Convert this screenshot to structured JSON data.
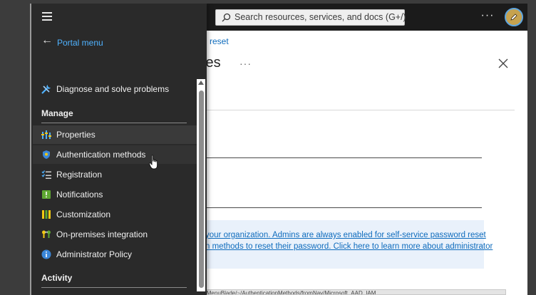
{
  "topbar": {
    "search_placeholder": "Search resources, services, and docs (G+/)",
    "more_label": "···"
  },
  "main": {
    "breadcrumb_fragment": "d reset",
    "title_fragment": "ies",
    "title_more": "···",
    "info_line1": "your organization. Admins are always enabled for self-service password reset",
    "info_line2": "n methods to reset their password. Click here to learn more about administrator"
  },
  "sidebar": {
    "back_label": "Portal menu",
    "top_item": {
      "label": "Diagnose and solve problems",
      "icon": "wrench-icon"
    },
    "section_manage": "Manage",
    "items": [
      {
        "label": "Properties",
        "icon": "properties-icon"
      },
      {
        "label": "Authentication methods",
        "icon": "shield-icon"
      },
      {
        "label": "Registration",
        "icon": "registration-icon"
      },
      {
        "label": "Notifications",
        "icon": "notification-icon"
      },
      {
        "label": "Customization",
        "icon": "customization-icon"
      },
      {
        "label": "On-premises integration",
        "icon": "onprem-icon"
      },
      {
        "label": "Administrator Policy",
        "icon": "info-icon"
      }
    ],
    "section_activity": "Activity"
  },
  "statusbar": {
    "url": "https://portal.azure.com/#view/Microsoft_AAD_IAM/PasswordResetMenuBlade/~/AuthenticationMethods/fromNav/Microsoft_AAD_IAM"
  },
  "colors": {
    "accent": "#0f6cbd",
    "sidebar_bg": "#2a2a2a",
    "topbar_bg": "#1b1b1b"
  }
}
